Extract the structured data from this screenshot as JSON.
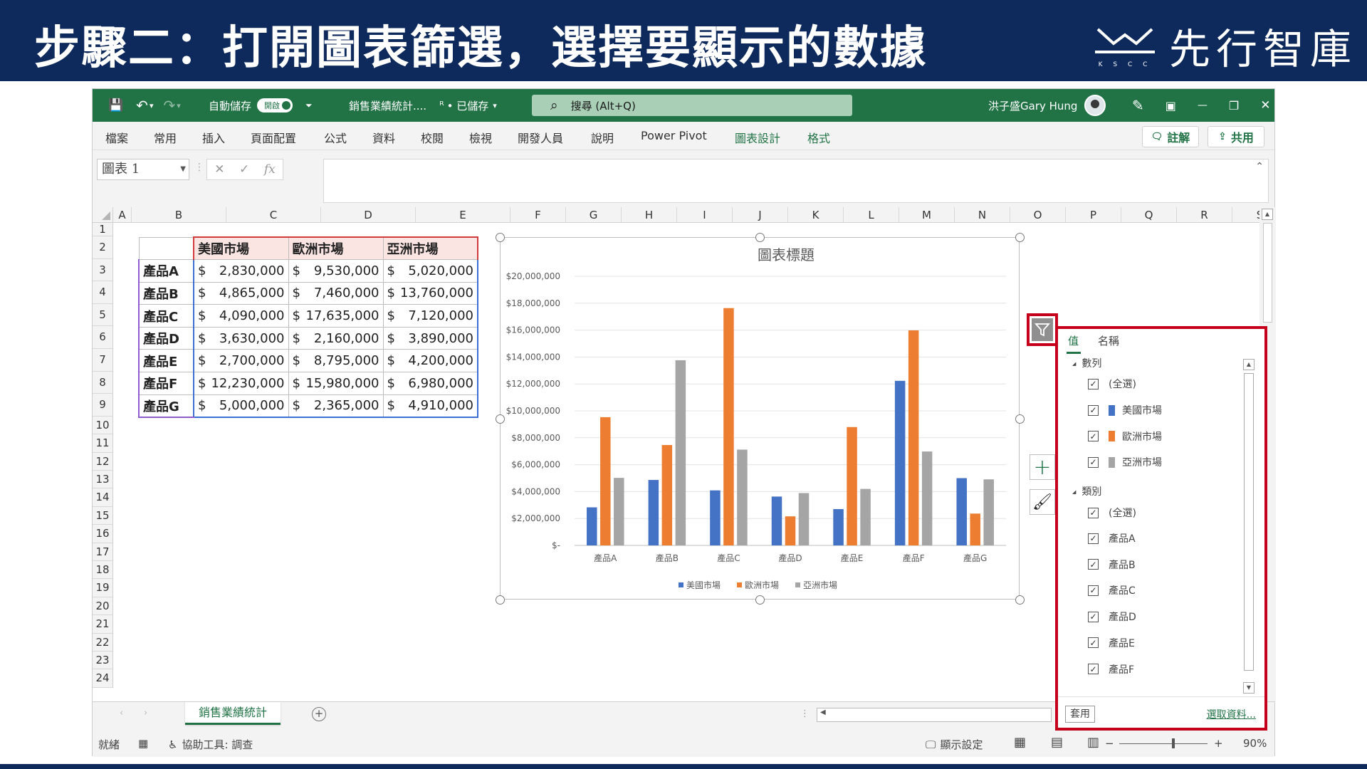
{
  "banner": {
    "title": "步驟二：打開圖表篩選，選擇要顯示的數據",
    "brand": "先行智庫",
    "brand_small": "K S C C"
  },
  "titlebar": {
    "autosave_label": "自動儲存",
    "autosave_state": "開啟",
    "filename": "銷售業績統計....",
    "saved_status": "• 已儲存",
    "search_placeholder": "搜尋 (Alt+Q)",
    "user_name": "洪子盛Gary Hung"
  },
  "ribbon": {
    "tabs": [
      "檔案",
      "常用",
      "插入",
      "頁面配置",
      "公式",
      "資料",
      "校閱",
      "檢視",
      "開發人員",
      "說明",
      "Power Pivot",
      "圖表設計",
      "格式"
    ],
    "comments_label": "註解",
    "share_label": "共用"
  },
  "formula_bar": {
    "name_box": "圖表 1",
    "fx_label": "fx"
  },
  "columns": [
    "A",
    "B",
    "C",
    "D",
    "E",
    "F",
    "G",
    "H",
    "I",
    "J",
    "K",
    "L",
    "M",
    "N",
    "O",
    "P",
    "Q",
    "R",
    "S"
  ],
  "rows": [
    "1",
    "2",
    "3",
    "4",
    "5",
    "6",
    "7",
    "8",
    "9",
    "10",
    "11",
    "12",
    "13",
    "14",
    "15",
    "16",
    "17",
    "18",
    "19",
    "20",
    "21",
    "22",
    "23",
    "24"
  ],
  "table": {
    "headers": [
      "美國市場",
      "歐洲市場",
      "亞洲市場"
    ],
    "currency": "$",
    "rows": [
      {
        "product": "產品A",
        "values": [
          "2,830,000",
          "9,530,000",
          "5,020,000"
        ]
      },
      {
        "product": "產品B",
        "values": [
          "4,865,000",
          "7,460,000",
          "13,760,000"
        ]
      },
      {
        "product": "產品C",
        "values": [
          "4,090,000",
          "17,635,000",
          "7,120,000"
        ]
      },
      {
        "product": "產品D",
        "values": [
          "3,630,000",
          "2,160,000",
          "3,890,000"
        ]
      },
      {
        "product": "產品E",
        "values": [
          "2,700,000",
          "8,795,000",
          "4,200,000"
        ]
      },
      {
        "product": "產品F",
        "values": [
          "12,230,000",
          "15,980,000",
          "6,980,000"
        ]
      },
      {
        "product": "產品G",
        "values": [
          "5,000,000",
          "2,365,000",
          "4,910,000"
        ]
      }
    ]
  },
  "chart_data": {
    "type": "bar",
    "title": "圖表標題",
    "categories": [
      "產品A",
      "產品B",
      "產品C",
      "產品D",
      "產品E",
      "產品F",
      "產品G"
    ],
    "series": [
      {
        "name": "美國市場",
        "color": "#4472c4",
        "values": [
          2830000,
          4865000,
          4090000,
          3630000,
          2700000,
          12230000,
          5000000
        ]
      },
      {
        "name": "歐洲市場",
        "color": "#ed7d31",
        "values": [
          9530000,
          7460000,
          17635000,
          2160000,
          8795000,
          15980000,
          2365000
        ]
      },
      {
        "name": "亞洲市場",
        "color": "#a5a5a5",
        "values": [
          5020000,
          13760000,
          7120000,
          3890000,
          4200000,
          6980000,
          4910000
        ]
      }
    ],
    "ylim": [
      0,
      20000000
    ],
    "y_ticks": [
      {
        "value": 0,
        "label": "$-"
      },
      {
        "value": 2000000,
        "label": "$2,000,000"
      },
      {
        "value": 4000000,
        "label": "$4,000,000"
      },
      {
        "value": 6000000,
        "label": "$6,000,000"
      },
      {
        "value": 8000000,
        "label": "$8,000,000"
      },
      {
        "value": 10000000,
        "label": "$10,000,000"
      },
      {
        "value": 12000000,
        "label": "$12,000,000"
      },
      {
        "value": 14000000,
        "label": "$14,000,000"
      },
      {
        "value": 16000000,
        "label": "$16,000,000"
      },
      {
        "value": 18000000,
        "label": "$18,000,000"
      },
      {
        "value": 20000000,
        "label": "$20,000,000"
      }
    ],
    "grid": true,
    "legend": "bottom"
  },
  "filter_pane": {
    "tab_value": "值",
    "tab_name": "名稱",
    "series_group": "數列",
    "category_group": "類別",
    "select_all": "(全選)",
    "series_items": [
      {
        "label": "美國市場",
        "color": "#4472c4"
      },
      {
        "label": "歐洲市場",
        "color": "#ed7d31"
      },
      {
        "label": "亞洲市場",
        "color": "#a5a5a5"
      }
    ],
    "category_items": [
      "產品A",
      "產品B",
      "產品C",
      "產品D",
      "產品E",
      "產品F"
    ],
    "check_mark": "✓",
    "apply_label": "套用",
    "select_data_label": "選取資料..."
  },
  "sheet": {
    "tab_name": "銷售業績統計",
    "add_sheet": "+"
  },
  "statusbar": {
    "ready": "就緒",
    "accessibility": "協助工具: 調查",
    "display_settings": "顯示設定",
    "zoom_minus": "−",
    "zoom_plus": "+",
    "zoom": "90%"
  },
  "icons": {
    "save": "💾",
    "undo": "↶",
    "redo": "↷",
    "customize": "⏷",
    "search": "⌕",
    "pen": "✎",
    "ribbon_display": "▣",
    "minimize": "—",
    "restore": "❐",
    "close": "✕",
    "comment": "🗨",
    "share": "⇪",
    "cancel": "✕",
    "enter": "✓",
    "collapse": "⌃",
    "plus": "+",
    "brush": "🖌",
    "filter": "▽",
    "macro": "▦",
    "accessibility": "♿",
    "normal_view": "▦",
    "page_layout": "▤",
    "page_break": "▥"
  },
  "colors": {
    "banner": "#0e2a5c",
    "excel_green": "#217346",
    "highlight": "#c4001a"
  }
}
